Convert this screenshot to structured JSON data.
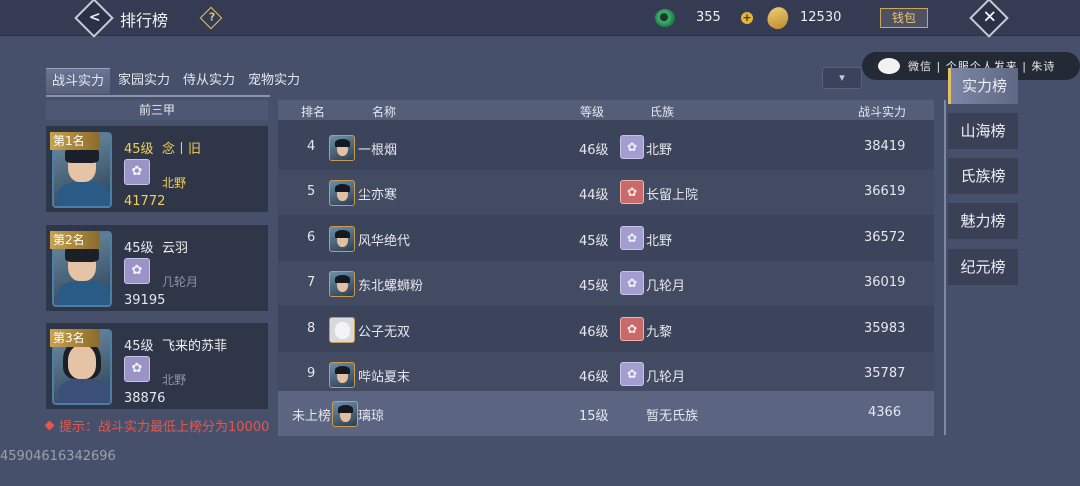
{
  "header": {
    "title": "排行榜",
    "help": "?",
    "back_icon": "back-arrow-icon",
    "currency": {
      "jade": "355",
      "gold": "12530",
      "plus": "+"
    },
    "wallet_label": "钱包",
    "close": "✕"
  },
  "watermark": {
    "text": "微信 | 个服个人发来 | 朱诗"
  },
  "tabs": [
    "战斗实力",
    "家园实力",
    "侍从实力",
    "宠物实力"
  ],
  "sort_dropdown": "",
  "podium": {
    "header": "前三甲",
    "cards": [
      {
        "rank": "第1名",
        "level": "45级",
        "name": "念丨旧",
        "clan": "北野",
        "power": "41772"
      },
      {
        "rank": "第2名",
        "level": "45级",
        "name": "云羽",
        "clan": "几轮月",
        "power": "39195"
      },
      {
        "rank": "第3名",
        "level": "45级",
        "name": "飞来的苏菲",
        "clan": "北野",
        "power": "38876"
      }
    ]
  },
  "table": {
    "columns": [
      "排名",
      "名称",
      "等级",
      "氏族",
      "战斗实力"
    ],
    "rows": [
      {
        "rank": "4",
        "name": "一根烟",
        "level": "46级",
        "clan": "北野",
        "power": "38419"
      },
      {
        "rank": "5",
        "name": "尘亦寒",
        "level": "44级",
        "clan": "长留上院",
        "power": "36619"
      },
      {
        "rank": "6",
        "name": "风华绝代",
        "level": "45级",
        "clan": "北野",
        "power": "36572"
      },
      {
        "rank": "7",
        "name": "东北螺蛳粉",
        "level": "45级",
        "clan": "几轮月",
        "power": "36019"
      },
      {
        "rank": "8",
        "name": "公子无双",
        "level": "46级",
        "clan": "九黎",
        "power": "35983"
      },
      {
        "rank": "9",
        "name": "哔站夏末",
        "level": "46级",
        "clan": "几轮月",
        "power": "35787"
      }
    ],
    "self": {
      "rank": "未上榜",
      "name": "璃琼",
      "level": "15级",
      "clan": "暂无氏族",
      "power": "4366"
    }
  },
  "tip": "提示：战斗实力最低上榜分为10000",
  "uid": "45904616342696",
  "right_nav": [
    "实力榜",
    "山海榜",
    "氏族榜",
    "魅力榜",
    "纪元榜"
  ]
}
